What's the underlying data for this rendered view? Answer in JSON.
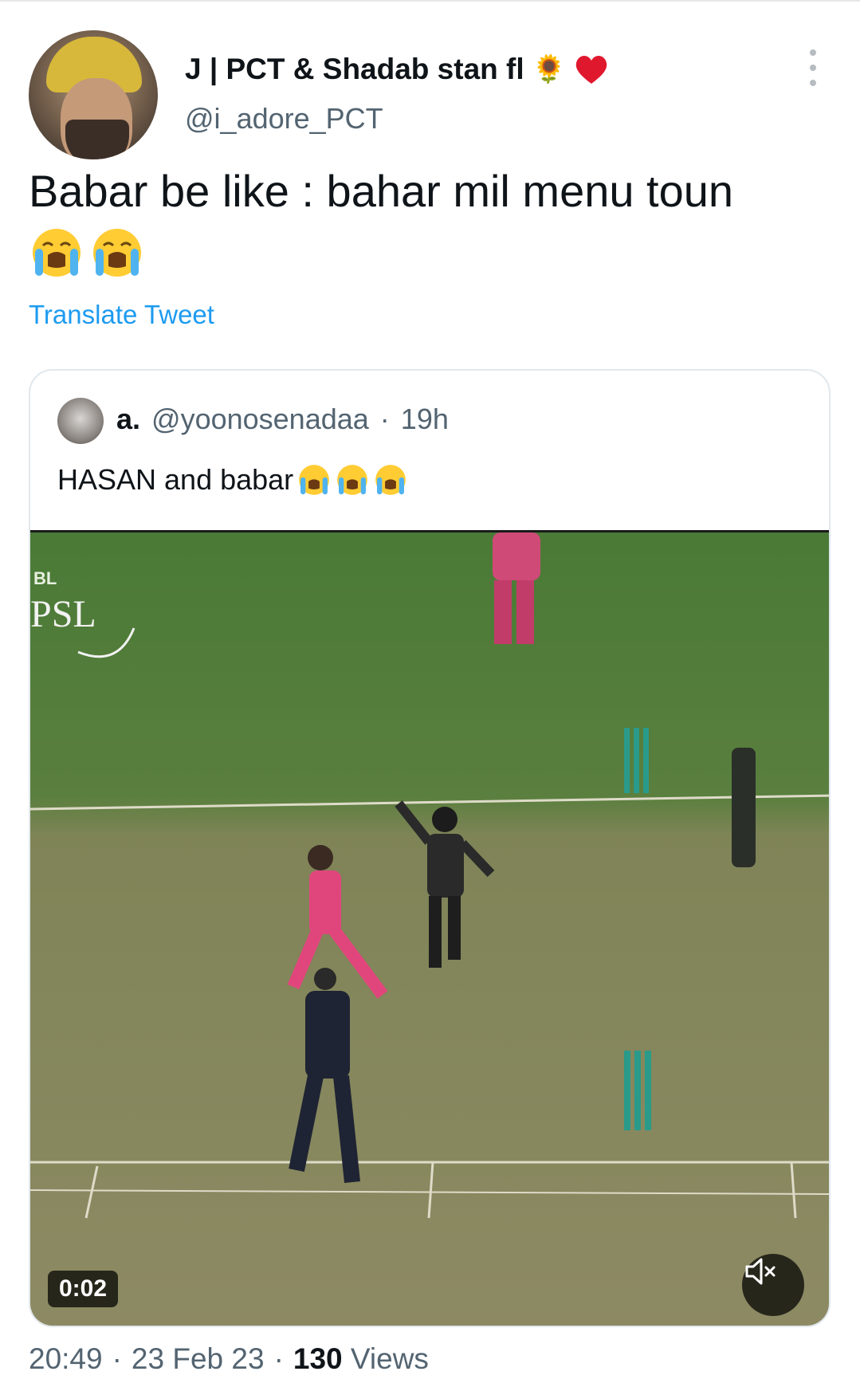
{
  "tweet": {
    "display_name": "J | PCT & Shadab stan fl",
    "name_emojis": [
      "sunflower",
      "red-heart"
    ],
    "handle": "@i_adore_PCT",
    "text": "Babar be like : bahar mil menu toun",
    "text_emojis": [
      "loudly-crying-face",
      "loudly-crying-face"
    ],
    "translate_label": "Translate Tweet",
    "time": "20:49",
    "date": "23 Feb 23",
    "views_count": "130",
    "views_label": "Views",
    "separator": "·"
  },
  "quoted_tweet": {
    "name": "a.",
    "handle": "@yoonosenadaa",
    "separator": "·",
    "age": "19h",
    "text": "HASAN and babar",
    "text_emojis": [
      "loudly-crying-face",
      "loudly-crying-face",
      "loudly-crying-face"
    ]
  },
  "video": {
    "duration": "0:02",
    "watermark": "PSL",
    "watermark_prefix": "BL",
    "muted": true
  },
  "colors": {
    "link": "#1d9bf0",
    "secondary_text": "#536471",
    "primary_text": "#0f1419",
    "pitch_green": "#4f7a3a",
    "pitch_brown": "#8f8a62"
  }
}
